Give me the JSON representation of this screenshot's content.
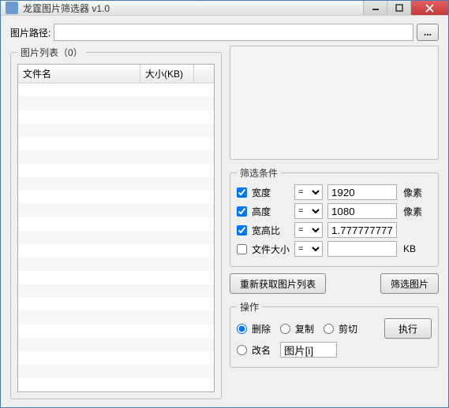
{
  "window": {
    "title": "龙霆图片筛选器 v1.0"
  },
  "path": {
    "label": "图片路径:",
    "value": "",
    "browse": "..."
  },
  "filelist": {
    "legend": "图片列表（0）",
    "col1": "文件名",
    "col2": "大小(KB)"
  },
  "conditions": {
    "legend": "筛选条件",
    "rows": [
      {
        "checked": true,
        "label": "宽度",
        "op": "=",
        "value": "1920",
        "unit": "像素"
      },
      {
        "checked": true,
        "label": "高度",
        "op": "=",
        "value": "1080",
        "unit": "像素"
      },
      {
        "checked": true,
        "label": "宽高比",
        "op": "=",
        "value": "1.77777777777",
        "unit": ""
      },
      {
        "checked": false,
        "label": "文件大小",
        "op": "=",
        "value": "",
        "unit": "KB"
      }
    ]
  },
  "buttons": {
    "reload": "重新获取图片列表",
    "filter": "筛选图片"
  },
  "ops": {
    "legend": "操作",
    "delete": "删除",
    "copy": "复制",
    "cut": "剪切",
    "rename": "改名",
    "rename_value": "图片[i]",
    "exec": "执行",
    "selected": "delete"
  }
}
